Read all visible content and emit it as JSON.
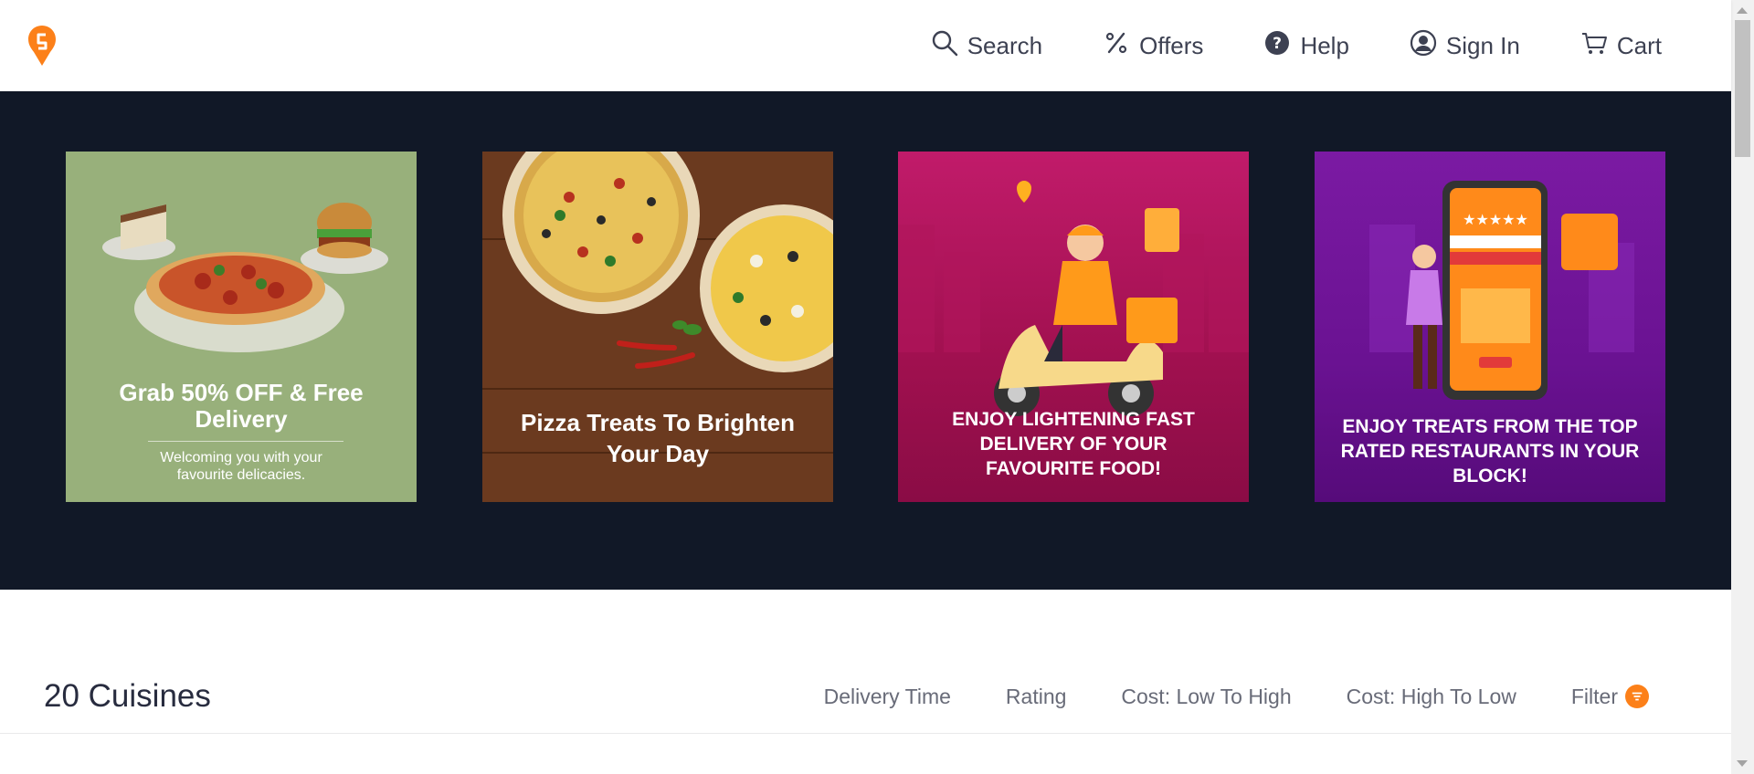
{
  "header": {
    "logo_color": "#fc8019",
    "nav": [
      {
        "label": "Search",
        "icon": "search-icon"
      },
      {
        "label": "Offers",
        "icon": "percent-icon"
      },
      {
        "label": "Help",
        "icon": "help-icon"
      },
      {
        "label": "Sign In",
        "icon": "user-icon"
      },
      {
        "label": "Cart",
        "icon": "cart-icon"
      }
    ]
  },
  "banner": {
    "background": "#111827",
    "cards": [
      {
        "title": "Grab 50% OFF & Free Delivery",
        "subtitle": "Welcoming you with your favourite delicacies."
      },
      {
        "title": "Pizza Treats To Brighten Your Day"
      },
      {
        "title": "ENJOY LIGHTENING FAST DELIVERY OF YOUR FAVOURITE FOOD!"
      },
      {
        "title": "ENJOY TREATS FROM THE TOP RATED RESTAURANTS IN YOUR BLOCK!"
      }
    ]
  },
  "listing": {
    "title": "20 Cuisines",
    "sorts": [
      "Delivery Time",
      "Rating",
      "Cost: Low To High",
      "Cost: High To Low"
    ],
    "filter_label": "Filter",
    "accent": "#fc8019"
  }
}
